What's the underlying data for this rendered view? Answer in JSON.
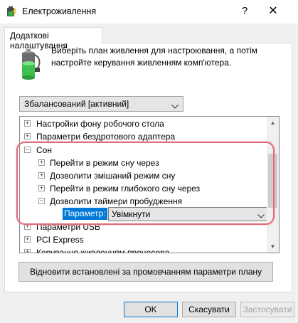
{
  "window": {
    "title": "Електроживлення",
    "help": "?",
    "close": "✕"
  },
  "tab": {
    "label": "Додаткові налаштування"
  },
  "description": "Виберіть план живлення для настроювання, а потім настройте керування живленням комп'ютера.",
  "plan_select": {
    "value": "Збалансований [активний]",
    "arrow": "⌄"
  },
  "tree": {
    "items": [
      {
        "label": "Настройки фону робочого стола",
        "level": 0,
        "expander": "+"
      },
      {
        "label": "Параметри бездротового адаптера",
        "level": 0,
        "expander": "+"
      },
      {
        "label": "Сон",
        "level": 0,
        "expander": "−"
      },
      {
        "label": "Перейти в режим сну через",
        "level": 1,
        "expander": "+"
      },
      {
        "label": "Дозволити змішаний режим сну",
        "level": 1,
        "expander": "+"
      },
      {
        "label": "Перейти в режим глибокого сну через",
        "level": 1,
        "expander": "+"
      },
      {
        "label": "Дозволити таймери пробудження",
        "level": 1,
        "expander": "−"
      },
      {
        "label": "Параметри USB",
        "level": 0,
        "expander": "+"
      },
      {
        "label": "PCI Express",
        "level": 0,
        "expander": "+"
      },
      {
        "label": "Керування живленням процесора",
        "level": 0,
        "expander": "+"
      }
    ],
    "parameter": {
      "label": "Параметр:",
      "value": "Увімкнути",
      "arrow": "⌄"
    },
    "scroll_up": "▲",
    "scroll_down": "▼"
  },
  "restore_button": "Відновити встановлені за промовчанням параметри плану",
  "buttons": {
    "ok": "OK",
    "cancel": "Скасувати",
    "apply": "Застосувати"
  },
  "colors": {
    "selection": "#0078d7",
    "highlight_outline": "#e06a7a"
  }
}
